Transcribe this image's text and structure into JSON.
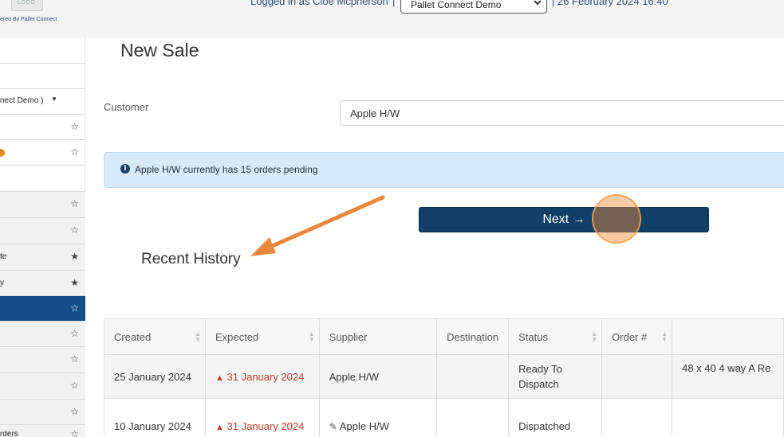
{
  "header": {
    "logo_text": "LOGO",
    "powered_by": "ered By Pallet Connect",
    "logged_in": "Logged in as Cloe Mcpherson",
    "separator": "|",
    "company": "Pallet Connect Demo",
    "datetime": "| 26 February 2024 16:40"
  },
  "sidebar": {
    "company_switch": "nect Demo )",
    "items": [
      "",
      "",
      "",
      "",
      "te",
      "y",
      "",
      "",
      "",
      "",
      "",
      "rders"
    ]
  },
  "main": {
    "title": "New Sale",
    "customer_label": "Customer",
    "customer_value": "Apple H/W",
    "info_text": "Apple H/W currently has 15 orders pending",
    "next_button": "Next →",
    "recent_history": "Recent History"
  },
  "table": {
    "headers": [
      "Created",
      "Expected",
      "Supplier",
      "Destination",
      "Status",
      "Order #",
      ""
    ],
    "rows": [
      {
        "created": "25 January 2024",
        "expected": "31 January 2024",
        "supplier": "Apple H/W",
        "destination": "",
        "status": "Ready To Dispatch",
        "order": "",
        "detail": "48 x 40 4 way A Re"
      },
      {
        "created": "10 January 2024",
        "expected": "31 January 2024",
        "supplier": "Apple H/W",
        "destination": "",
        "status": "Dispatched",
        "order": "",
        "detail": ""
      }
    ]
  },
  "colors": {
    "primary": "#123f67",
    "info_bg": "#d7eafa",
    "warning": "#c0392b",
    "annotation": "#e8883a"
  }
}
